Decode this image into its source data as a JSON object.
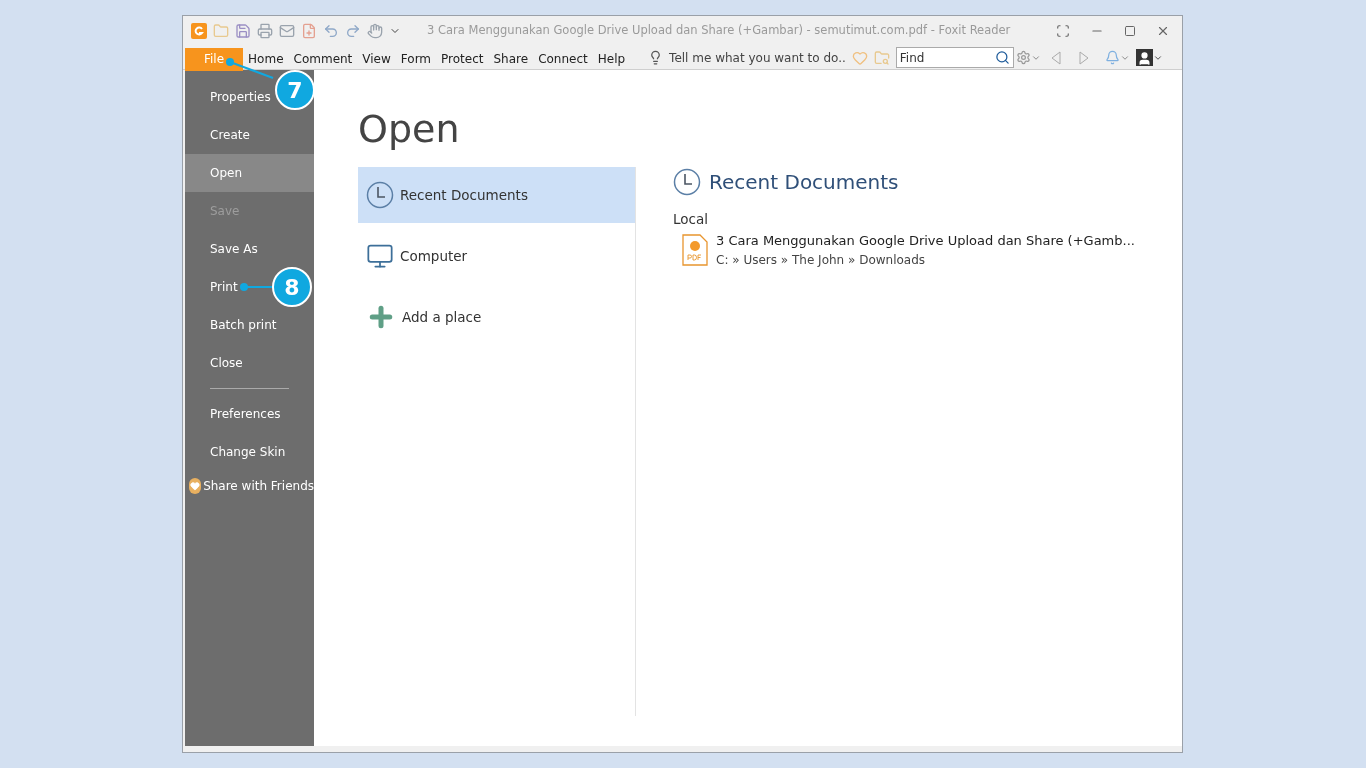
{
  "window": {
    "title": "3 Cara Menggunakan Google Drive Upload dan Share (+Gambar) - semutimut.com.pdf - Foxit Reader"
  },
  "menu_tabs": [
    {
      "label": "File",
      "selected": true,
      "callout": "7"
    },
    {
      "label": "Home",
      "selected": false
    },
    {
      "label": "Comment",
      "selected": false
    },
    {
      "label": "View",
      "selected": false
    },
    {
      "label": "Form",
      "selected": false
    },
    {
      "label": "Protect",
      "selected": false
    },
    {
      "label": "Share",
      "selected": false
    },
    {
      "label": "Connect",
      "selected": false
    },
    {
      "label": "Help",
      "selected": false
    }
  ],
  "tell_me": "Tell me what you want to do..",
  "search": {
    "placeholder": "Find"
  },
  "sidebar": {
    "items": [
      {
        "kind": "item",
        "label": "Properties",
        "selected": false,
        "disabled": false
      },
      {
        "kind": "item",
        "label": "Create",
        "selected": false,
        "disabled": false
      },
      {
        "kind": "item",
        "label": "Open",
        "selected": true,
        "disabled": false
      },
      {
        "kind": "item",
        "label": "Save",
        "selected": false,
        "disabled": true
      },
      {
        "kind": "item",
        "label": "Save As",
        "selected": false,
        "disabled": false
      },
      {
        "kind": "item",
        "label": "Print",
        "selected": false,
        "disabled": false,
        "callout": "8"
      },
      {
        "kind": "item",
        "label": "Batch print",
        "selected": false,
        "disabled": false
      },
      {
        "kind": "item",
        "label": "Close",
        "selected": false,
        "disabled": false
      },
      {
        "kind": "separator"
      },
      {
        "kind": "item",
        "label": "Preferences",
        "selected": false,
        "disabled": false
      },
      {
        "kind": "item",
        "label": "Change Skin",
        "selected": false,
        "disabled": false
      },
      {
        "kind": "share",
        "label": "Share with Friends",
        "selected": false,
        "disabled": false
      }
    ]
  },
  "open_panel": {
    "title": "Open",
    "places": [
      {
        "kind": "recent",
        "label": "Recent Documents",
        "selected": true
      },
      {
        "kind": "computer",
        "label": "Computer",
        "selected": false
      },
      {
        "kind": "add",
        "label": "Add a place",
        "selected": false
      }
    ],
    "recent": {
      "title": "Recent Documents",
      "section": "Local",
      "files": [
        {
          "name": "3 Cara Menggunakan Google Drive Upload dan Share (+Gamb...",
          "path": "C: » Users » The John » Downloads"
        }
      ]
    }
  }
}
